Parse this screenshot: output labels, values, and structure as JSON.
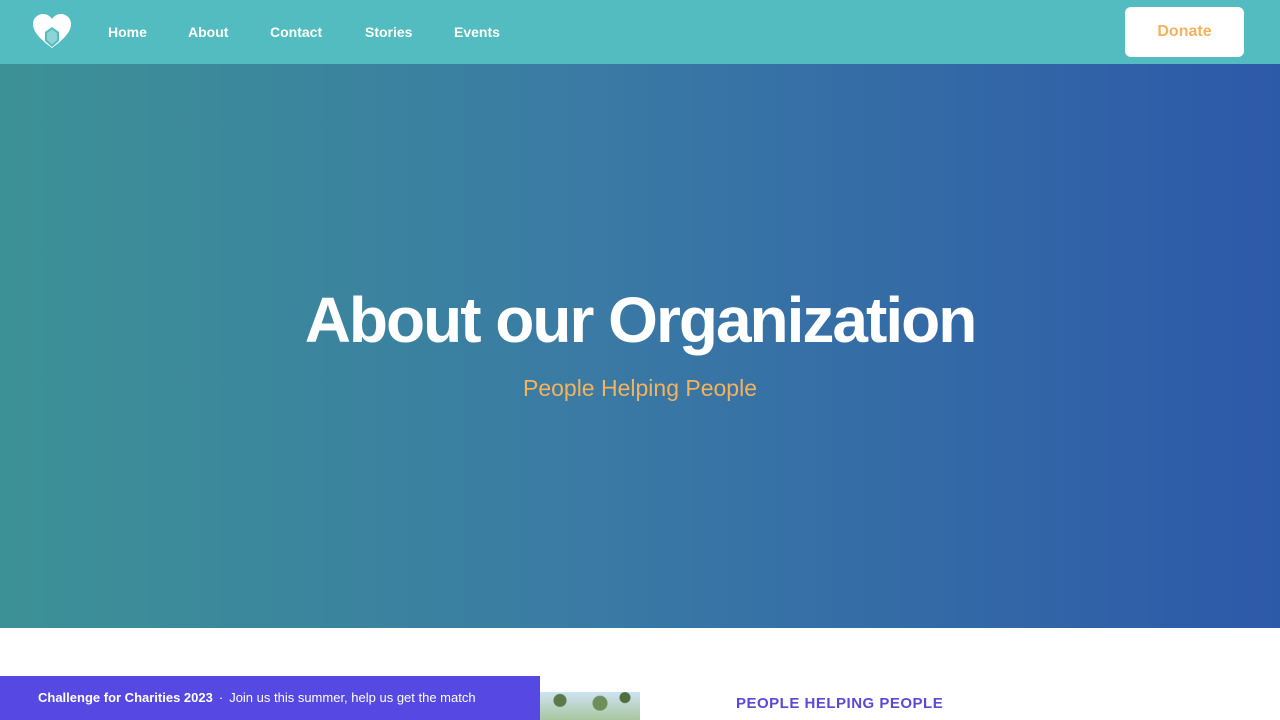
{
  "nav": {
    "logo_icon": "heart-hands-icon",
    "links": [
      "Home",
      "About",
      "Contact",
      "Stories",
      "Events"
    ],
    "donate_label": "Donate"
  },
  "hero": {
    "title": "About our Organization",
    "subtitle": "People Helping People"
  },
  "section": {
    "heading": "PEOPLE HELPING PEOPLE"
  },
  "banner": {
    "title": "Challenge for Charities 2023",
    "separator": "·",
    "message": "Join us this summer, help us get the match"
  },
  "colors": {
    "topbar": "#52bcc0",
    "accent_orange": "#f5b25c",
    "banner": "#5548e3",
    "heading_purple": "#5b48d9"
  }
}
